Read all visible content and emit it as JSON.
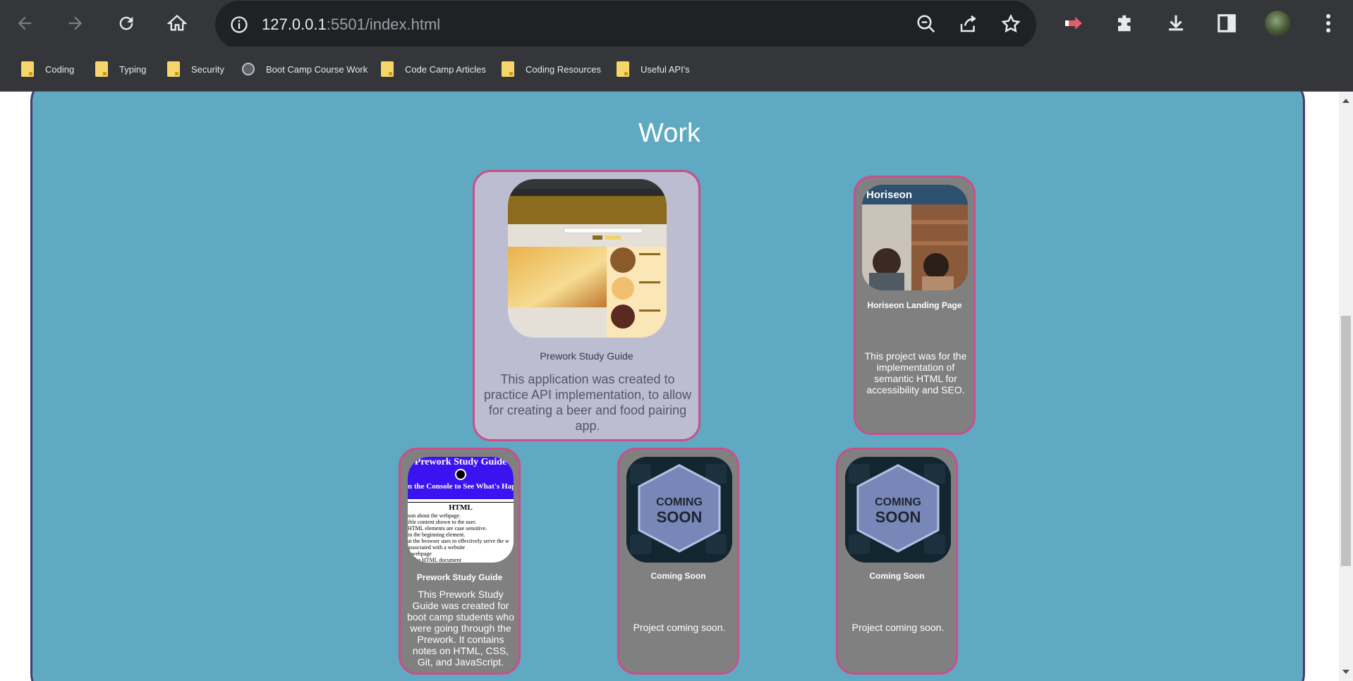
{
  "browser": {
    "url_host": "127.0.0.1",
    "url_rest": ":5501/index.html",
    "bookmarks": [
      {
        "label": "Coding",
        "icon": "folder-icon"
      },
      {
        "label": "Typing",
        "icon": "folder-icon"
      },
      {
        "label": "Security",
        "icon": "folder-icon"
      },
      {
        "label": "Boot Camp Course Work",
        "icon": "globe-icon"
      },
      {
        "label": "Code Camp Articles",
        "icon": "folder-icon"
      },
      {
        "label": "Coding Resources",
        "icon": "folder-icon"
      },
      {
        "label": "Useful API's",
        "icon": "folder-icon"
      }
    ]
  },
  "page": {
    "section_title": "Work",
    "colors": {
      "section_bg": "#5fa9c2",
      "card_bg": "#808080",
      "featured_card_bg": "#bcbdd0",
      "card_border": "#c94f8a"
    },
    "cards": [
      {
        "title": "Prework Study Guide",
        "description": "This application was created to practice API implementation, to allow for creating a beer and food pairing app."
      },
      {
        "title": "Horiseon Landing Page",
        "thumb_text": "Horiseon",
        "description": "This project was for the implementation of semantic HTML for accessibility and SEO."
      },
      {
        "title": "Prework Study Guide",
        "thumb_header": "Prework Study Guide",
        "thumb_subheader": "n the Console to See What's Happe",
        "thumb_heading": "HTML",
        "thumb_lines": [
          "son about the webpage.",
          "ible content shown to the user.",
          "HTML elements are case sensitive.",
          "in the beginning element.",
          "at the browser uses to effectively serve the w",
          "associated with a website",
          "a webpage",
          "in the HTML document"
        ],
        "description": "This Prework Study Guide was created for boot camp students who were going through the Prework. It contains notes on HTML, CSS, Git, and JavaScript."
      },
      {
        "title": "Coming Soon",
        "thumb_text_1": "COMING",
        "thumb_text_2": "SOON",
        "description": "Project coming soon."
      },
      {
        "title": "Coming Soon",
        "thumb_text_1": "COMING",
        "thumb_text_2": "SOON",
        "description": "Project coming soon."
      }
    ]
  }
}
